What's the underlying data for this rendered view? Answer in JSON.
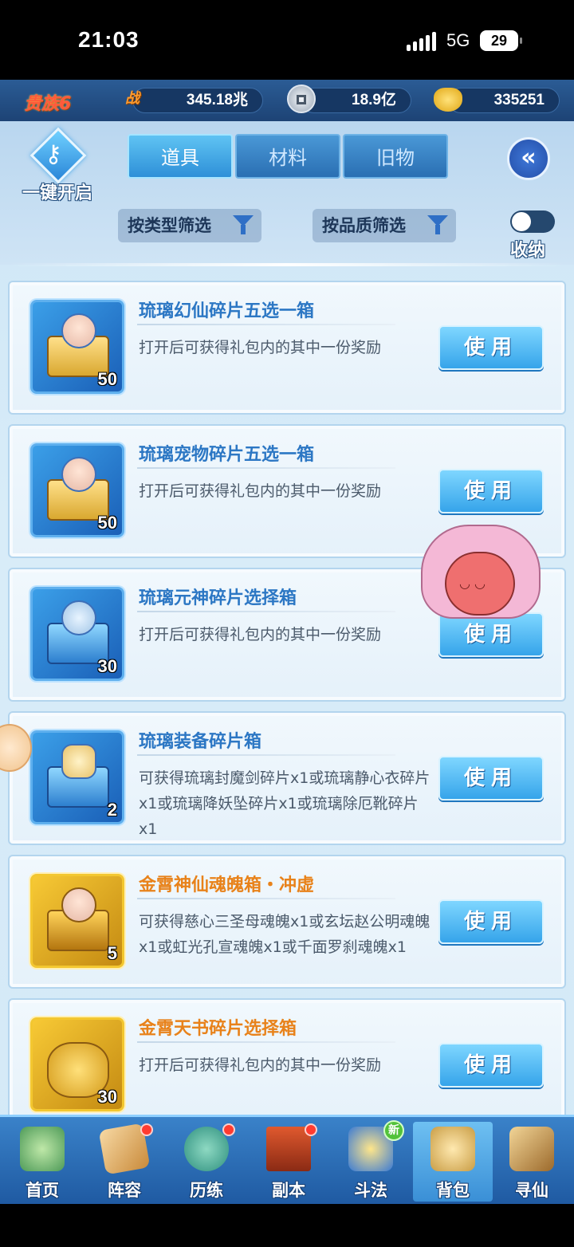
{
  "status_bar": {
    "time": "21:03",
    "network": "5G",
    "battery": "29"
  },
  "resources": {
    "rank": "贵族6",
    "power_icon_text": "战",
    "power": "345.18兆",
    "silver": "18.9亿",
    "gold": "335251"
  },
  "header": {
    "one_click_open": "一键开启",
    "tabs": [
      {
        "label": "道具",
        "active": true
      },
      {
        "label": "材料",
        "active": false
      },
      {
        "label": "旧物",
        "active": false
      }
    ],
    "back_icon": "chevron-left-double-icon",
    "filter_type": "按类型筛选",
    "filter_quality": "按品质筛选",
    "collapse_label": "收纳"
  },
  "items": [
    {
      "title": "琉璃幻仙碎片五选一箱",
      "desc": "打开后可获得礼包内的其中一份奖励",
      "count": "50",
      "quality": "blue",
      "button": "使用"
    },
    {
      "title": "琉璃宠物碎片五选一箱",
      "desc": "打开后可获得礼包内的其中一份奖励",
      "count": "50",
      "quality": "blue",
      "button": "使用"
    },
    {
      "title": "琉璃元神碎片选择箱",
      "desc": "打开后可获得礼包内的其中一份奖励",
      "count": "30",
      "quality": "blue",
      "button": "使用"
    },
    {
      "title": "琉璃装备碎片箱",
      "desc": "可获得琉璃封魔剑碎片x1或琉璃静心衣碎片x1或琉璃降妖坠碎片x1或琉璃除厄靴碎片x1",
      "count": "2",
      "quality": "blue",
      "button": "使用"
    },
    {
      "title": "金霄神仙魂魄箱・冲虚",
      "desc": "可获得慈心三圣母魂魄x1或玄坛赵公明魂魄x1或虹光孔宣魂魄x1或千面罗刹魂魄x1",
      "count": "5",
      "quality": "gold",
      "button": "使用"
    },
    {
      "title": "金霄天书碎片选择箱",
      "desc": "打开后可获得礼包内的其中一份奖励",
      "count": "30",
      "quality": "gold",
      "button": "使用"
    }
  ],
  "bottom_nav": [
    {
      "label": "首页",
      "icon": "floating-island-icon",
      "badge": "",
      "active": false
    },
    {
      "label": "阵容",
      "icon": "cards-icon",
      "badge": "dot",
      "active": false
    },
    {
      "label": "历练",
      "icon": "gourd-icon",
      "badge": "dot",
      "active": false
    },
    {
      "label": "副本",
      "icon": "gate-icon",
      "badge": "dot",
      "active": false
    },
    {
      "label": "斗法",
      "icon": "sword-shield-icon",
      "badge": "新",
      "active": false
    },
    {
      "label": "背包",
      "icon": "bag-icon",
      "badge": "",
      "active": true
    },
    {
      "label": "寻仙",
      "icon": "scroll-icon",
      "badge": "",
      "active": false
    }
  ],
  "colors": {
    "accent_blue": "#35a4ea",
    "blue_title": "#2c77c4",
    "gold_title": "#e8821a",
    "rank_red": "#ff5a3c"
  }
}
